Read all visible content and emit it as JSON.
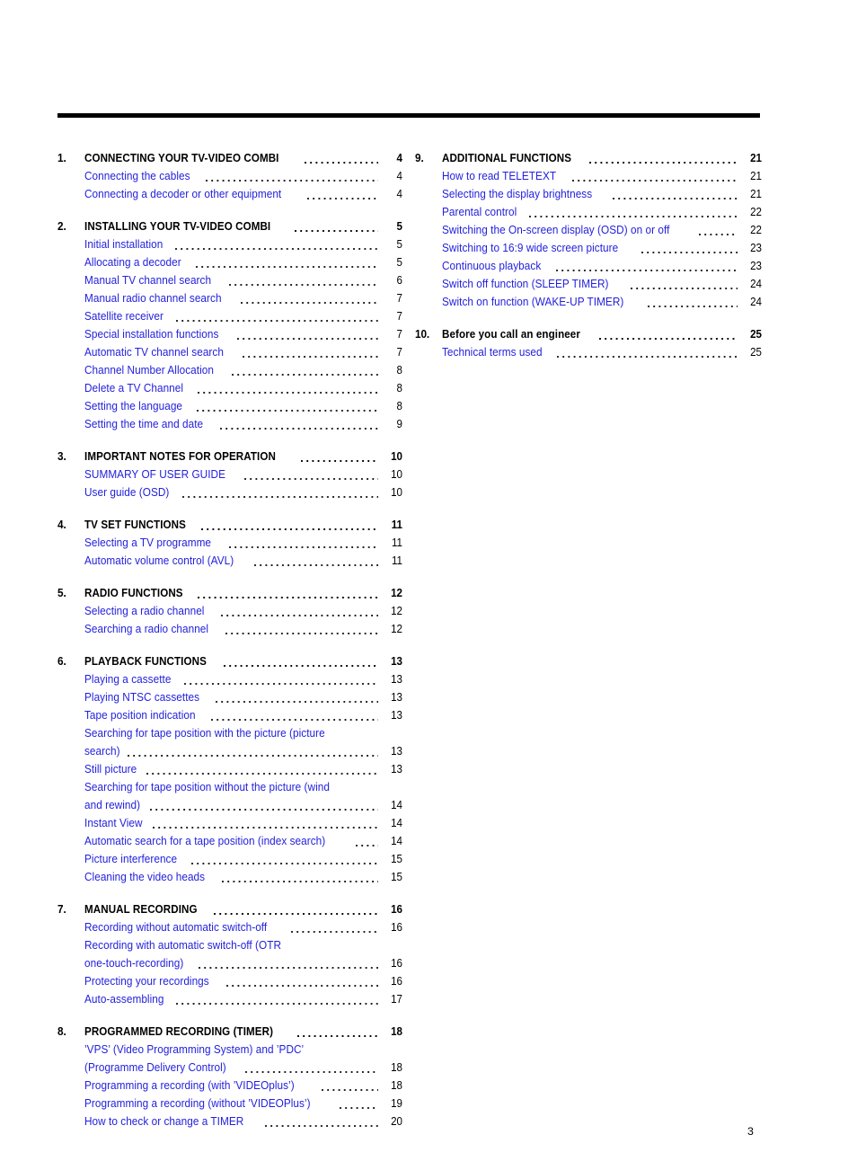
{
  "document": {
    "folio": "3"
  },
  "toc": {
    "left_column": [
      {
        "number": "1.",
        "heading": {
          "label": "CONNECTING YOUR TV-VIDEO COMBI",
          "page": "4"
        },
        "entries": [
          {
            "lines": [
              "Connecting the cables"
            ],
            "page": "4"
          },
          {
            "lines": [
              "Connecting a decoder or other equipment"
            ],
            "page": "4"
          }
        ]
      },
      {
        "number": "2.",
        "heading": {
          "label": "INSTALLING YOUR TV-VIDEO COMBI",
          "page": "5"
        },
        "entries": [
          {
            "lines": [
              "Initial installation"
            ],
            "page": "5"
          },
          {
            "lines": [
              "Allocating a decoder"
            ],
            "page": "5"
          },
          {
            "lines": [
              "Manual TV channel search"
            ],
            "page": "6"
          },
          {
            "lines": [
              "Manual radio channel search"
            ],
            "page": "7"
          },
          {
            "lines": [
              "Satellite receiver"
            ],
            "page": "7"
          },
          {
            "lines": [
              "Special installation functions"
            ],
            "page": "7"
          },
          {
            "lines": [
              "Automatic TV channel search"
            ],
            "page": "7"
          },
          {
            "lines": [
              "Channel Number Allocation"
            ],
            "page": "8"
          },
          {
            "lines": [
              "Delete a TV Channel"
            ],
            "page": "8"
          },
          {
            "lines": [
              "Setting the language"
            ],
            "page": "8"
          },
          {
            "lines": [
              "Setting the time and date"
            ],
            "page": "9"
          }
        ]
      },
      {
        "number": "3.",
        "heading": {
          "label": "IMPORTANT NOTES FOR OPERATION",
          "page": "10"
        },
        "entries": [
          {
            "lines": [
              "SUMMARY OF USER GUIDE"
            ],
            "page": "10"
          },
          {
            "lines": [
              "User guide (OSD)"
            ],
            "page": "10"
          }
        ]
      },
      {
        "number": "4.",
        "heading": {
          "label": "TV SET FUNCTIONS",
          "page": "11"
        },
        "entries": [
          {
            "lines": [
              "Selecting a TV programme"
            ],
            "page": "11"
          },
          {
            "lines": [
              "Automatic volume control (AVL)"
            ],
            "page": "11"
          }
        ]
      },
      {
        "number": "5.",
        "heading": {
          "label": "RADIO FUNCTIONS",
          "page": "12"
        },
        "entries": [
          {
            "lines": [
              "Selecting a radio channel"
            ],
            "page": "12"
          },
          {
            "lines": [
              "Searching a radio channel"
            ],
            "page": "12"
          }
        ]
      },
      {
        "number": "6.",
        "heading": {
          "label": "PLAYBACK FUNCTIONS",
          "page": "13"
        },
        "entries": [
          {
            "lines": [
              "Playing a cassette"
            ],
            "page": "13"
          },
          {
            "lines": [
              "Playing NTSC cassettes"
            ],
            "page": "13"
          },
          {
            "lines": [
              "Tape position indication"
            ],
            "page": "13"
          },
          {
            "lines": [
              "Searching for tape position with the picture (picture",
              "search)"
            ],
            "page": "13"
          },
          {
            "lines": [
              "Still picture"
            ],
            "page": "13"
          },
          {
            "lines": [
              "Searching for tape position without the picture (wind",
              "and rewind)"
            ],
            "page": "14"
          },
          {
            "lines": [
              "Instant View"
            ],
            "page": "14"
          },
          {
            "lines": [
              "Automatic search for a tape position (index search)"
            ],
            "page": "14"
          },
          {
            "lines": [
              "Picture interference"
            ],
            "page": "15"
          },
          {
            "lines": [
              "Cleaning the video heads"
            ],
            "page": "15"
          }
        ]
      },
      {
        "number": "7.",
        "heading": {
          "label": "MANUAL RECORDING",
          "page": "16"
        },
        "entries": [
          {
            "lines": [
              "Recording without automatic switch-off"
            ],
            "page": "16"
          },
          {
            "lines": [
              "Recording with automatic switch-off (OTR",
              "one-touch-recording)"
            ],
            "page": "16"
          },
          {
            "lines": [
              "Protecting your recordings"
            ],
            "page": "16"
          },
          {
            "lines": [
              "Auto-assembling"
            ],
            "page": "17"
          }
        ]
      },
      {
        "number": "8.",
        "heading": {
          "label": "PROGRAMMED RECORDING (TIMER)",
          "page": "18"
        },
        "entries": [
          {
            "lines": [
              "’VPS’ (Video Programming System) and ’PDC’",
              "(Programme Delivery Control)"
            ],
            "page": "18"
          },
          {
            "lines": [
              "Programming a recording (with ’VIDEOplus’)"
            ],
            "page": "18"
          },
          {
            "lines": [
              "Programming a recording (without ’VIDEOPlus’)"
            ],
            "page": "19"
          },
          {
            "lines": [
              "How to check or change a TIMER"
            ],
            "page": "20"
          }
        ]
      }
    ],
    "right_column": [
      {
        "number": "9.",
        "heading": {
          "label": "ADDITIONAL FUNCTIONS",
          "page": "21"
        },
        "entries": [
          {
            "lines": [
              "How to read TELETEXT"
            ],
            "page": "21"
          },
          {
            "lines": [
              "Selecting the display brightness"
            ],
            "page": "21"
          },
          {
            "lines": [
              "Parental control"
            ],
            "page": "22"
          },
          {
            "lines": [
              "Switching the On-screen display (OSD) on or off"
            ],
            "page": "22"
          },
          {
            "lines": [
              "Switching to 16:9 wide screen picture"
            ],
            "page": "23"
          },
          {
            "lines": [
              "Continuous playback"
            ],
            "page": "23"
          },
          {
            "lines": [
              "Switch off function (SLEEP TIMER)"
            ],
            "page": "24"
          },
          {
            "lines": [
              "Switch on function (WAKE-UP TIMER)"
            ],
            "page": "24"
          }
        ]
      },
      {
        "number": "10.",
        "heading": {
          "label": "Before you call an engineer",
          "page": "25"
        },
        "entries": [
          {
            "lines": [
              "Technical terms used"
            ],
            "page": "25"
          }
        ]
      }
    ]
  },
  "colors": {
    "entry_blue": "#2321dd",
    "heading_black": "#000000",
    "rule_black": "#000000"
  }
}
